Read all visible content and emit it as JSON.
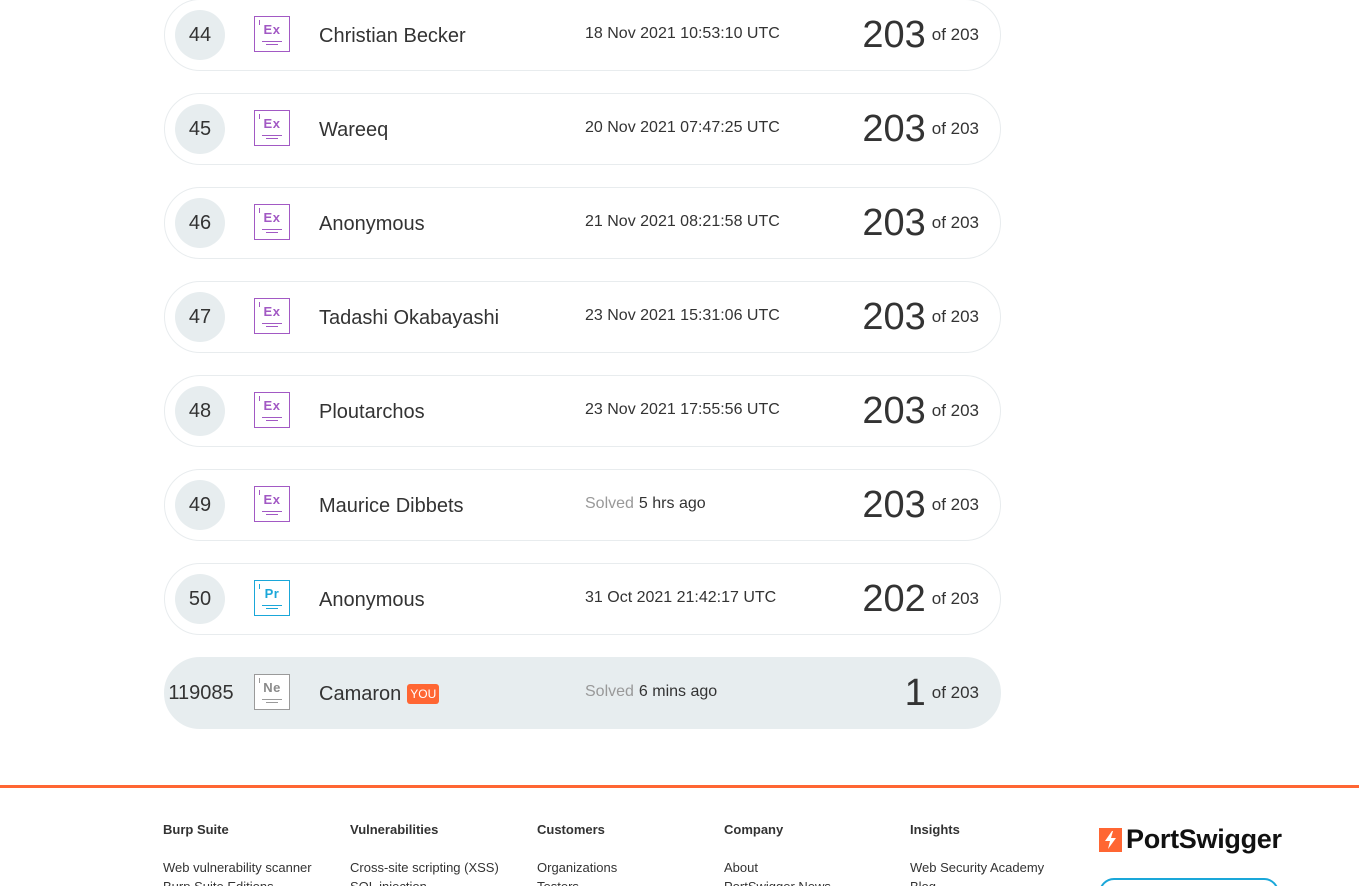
{
  "leaderboard": {
    "rows": [
      {
        "rank": "44",
        "level": "Ex",
        "level_class": "lvl-ex",
        "name": "Christian Becker",
        "date": "18 Nov 2021 10:53:10 UTC",
        "solved_label": "",
        "score": "203",
        "of": "of 203",
        "you": ""
      },
      {
        "rank": "45",
        "level": "Ex",
        "level_class": "lvl-ex",
        "name": "Wareeq",
        "date": "20 Nov 2021 07:47:25 UTC",
        "solved_label": "",
        "score": "203",
        "of": "of 203",
        "you": ""
      },
      {
        "rank": "46",
        "level": "Ex",
        "level_class": "lvl-ex",
        "name": "Anonymous",
        "date": "21 Nov 2021 08:21:58 UTC",
        "solved_label": "",
        "score": "203",
        "of": "of 203",
        "you": ""
      },
      {
        "rank": "47",
        "level": "Ex",
        "level_class": "lvl-ex",
        "name": "Tadashi Okabayashi",
        "date": "23 Nov 2021 15:31:06 UTC",
        "solved_label": "",
        "score": "203",
        "of": "of 203",
        "you": ""
      },
      {
        "rank": "48",
        "level": "Ex",
        "level_class": "lvl-ex",
        "name": "Ploutarchos",
        "date": "23 Nov 2021 17:55:56 UTC",
        "solved_label": "",
        "score": "203",
        "of": "of 203",
        "you": ""
      },
      {
        "rank": "49",
        "level": "Ex",
        "level_class": "lvl-ex",
        "name": "Maurice Dibbets",
        "date": "5 hrs ago",
        "solved_label": "Solved",
        "score": "203",
        "of": "of 203",
        "you": ""
      },
      {
        "rank": "50",
        "level": "Pr",
        "level_class": "lvl-pr",
        "name": "Anonymous",
        "date": "31 Oct 2021 21:42:17 UTC",
        "solved_label": "",
        "score": "202",
        "of": "of 203",
        "you": ""
      },
      {
        "rank": "119085",
        "level": "Ne",
        "level_class": "lvl-ne",
        "name": "Camaron",
        "date": "6 mins ago",
        "solved_label": "Solved",
        "score": "1",
        "of": "of 203",
        "you": "YOU"
      }
    ]
  },
  "footer": {
    "columns": [
      {
        "heading": "Burp Suite",
        "links": [
          "Web vulnerability scanner",
          "Burp Suite Editions"
        ]
      },
      {
        "heading": "Vulnerabilities",
        "links": [
          "Cross-site scripting (XSS)",
          "SQL injection"
        ]
      },
      {
        "heading": "Customers",
        "links": [
          "Organizations",
          "Testers"
        ]
      },
      {
        "heading": "Company",
        "links": [
          "About",
          "PortSwigger News"
        ]
      },
      {
        "heading": "Insights",
        "links": [
          "Web Security Academy",
          "Blog"
        ]
      }
    ],
    "logo_text": "PortSwigger",
    "logo_icon": "portswigger-bolt-icon",
    "accent_color": "#ff6633"
  }
}
